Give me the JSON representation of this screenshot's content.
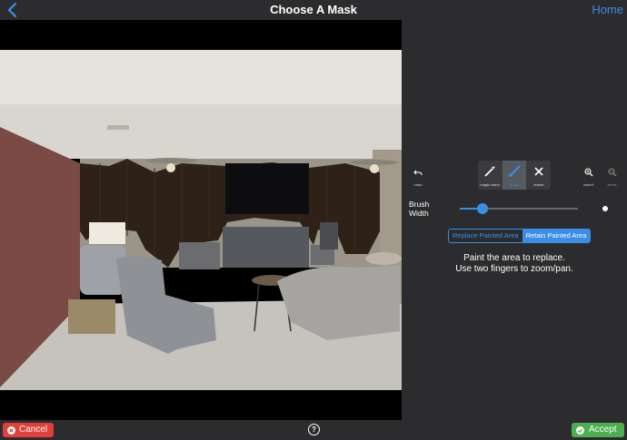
{
  "header": {
    "title": "Choose A Mask",
    "home_label": "Home",
    "back_icon": "chevron-left-icon"
  },
  "tools": {
    "undo_label": "undo",
    "magic_wand_label": "magic wand",
    "brush_label": "brush",
    "eraser_label": "eraser",
    "zoom_in_label": "zoom+",
    "zoom_out_label": "zoom-",
    "active_tool": "brush"
  },
  "brush_width": {
    "label_line1": "Brush",
    "label_line2": "Width",
    "value_fraction": 0.19
  },
  "mode": {
    "options": [
      "Replace Painted Area",
      "Retain Painted Area"
    ],
    "selected": "Retain Painted Area"
  },
  "instructions": {
    "line1": "Paint the area to replace.",
    "line2": "Use two fingers to zoom/pan."
  },
  "footer": {
    "cancel_label": "Cancel",
    "accept_label": "Accept",
    "help_label": "?"
  },
  "colors": {
    "accent": "#3a8ee6",
    "cancel": "#e0403a",
    "accept": "#4caf50",
    "background": "#2c2c2e"
  }
}
